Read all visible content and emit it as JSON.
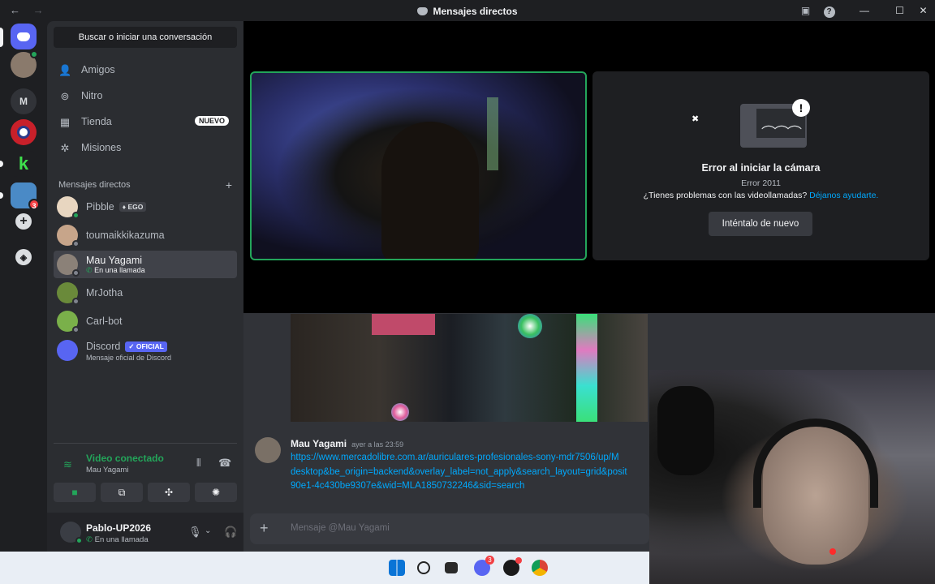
{
  "window": {
    "title": "Mensajes directos",
    "back": "←",
    "forward": "→",
    "minimize": "—",
    "maximize": "☐",
    "close": "✕"
  },
  "servers": {
    "home_letter": "M"
  },
  "sidebar": {
    "search_label": "Buscar o iniciar una conversación",
    "nav": [
      {
        "label": "Amigos",
        "icon": "friends-icon"
      },
      {
        "label": "Nitro",
        "icon": "nitro-icon"
      },
      {
        "label": "Tienda",
        "icon": "shop-icon",
        "badge": "NUEVO"
      },
      {
        "label": "Misiones",
        "icon": "quests-icon"
      }
    ],
    "dm_header": "Mensajes directos",
    "dms": [
      {
        "name": "Pibble",
        "tag": "EGO"
      },
      {
        "name": "toumaikkikazuma"
      },
      {
        "name": "Mau Yagami",
        "sub": "En una llamada"
      },
      {
        "name": "MrJotha"
      },
      {
        "name": "Carl-bot"
      },
      {
        "name": "Discord",
        "tag": "✓ OFICIAL",
        "sub": "Mensaje oficial de Discord"
      }
    ]
  },
  "voice": {
    "status": "Video conectado",
    "channel": "Mau Yagami"
  },
  "user": {
    "name": "Pablo-UP2026",
    "status": "En una llamada"
  },
  "camera_error": {
    "title": "Error al iniciar la cámara",
    "code": "Error 2011",
    "help_text": "¿Tienes problemas con las videollamadas?",
    "help_link": "Déjanos ayudarte.",
    "retry": "Inténtalo de nuevo"
  },
  "message": {
    "author": "Mau Yagami",
    "time": "ayer a las 23:59",
    "link_lines": [
      "https://www.mercadolibre.com.ar/auriculares-profesionales-sony-mdr7506/up/M",
      "desktop&be_origin=backend&overlay_label=not_apply&search_layout=grid&posit",
      "90e1-4c430be9307e&wid=MLA1850732246&sid=search"
    ]
  },
  "composer": {
    "placeholder": "Mensaje @Mau Yagami"
  },
  "colors": {
    "accent": "#5865f2",
    "online": "#23a55a",
    "link": "#00a8fc",
    "danger": "#f23f43"
  }
}
